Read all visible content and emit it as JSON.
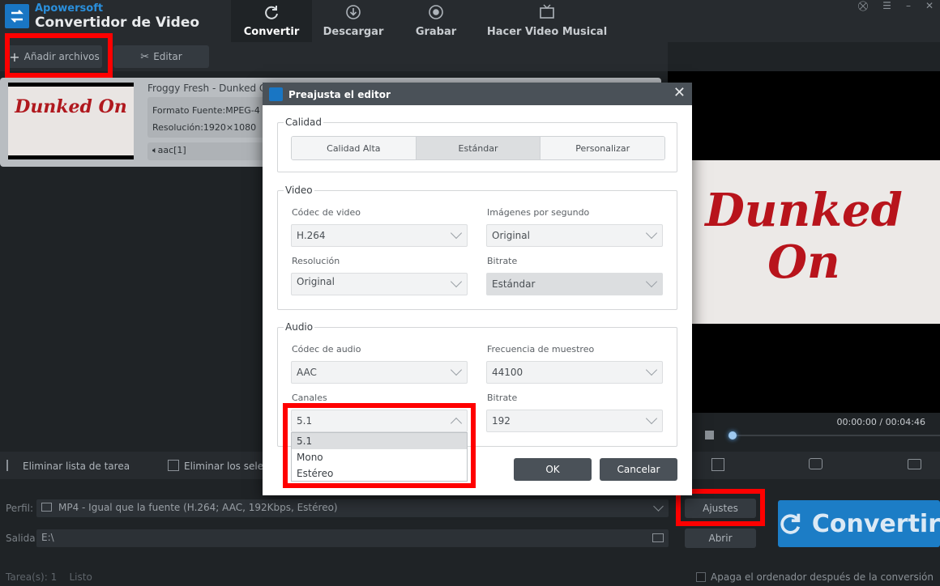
{
  "app": {
    "brand_small": "Apowersoft",
    "brand_big": "Convertidor de Video"
  },
  "nav": {
    "tabs": [
      {
        "label": "Convertir",
        "icon": "refresh-icon",
        "active": true
      },
      {
        "label": "Descargar",
        "icon": "download-icon",
        "active": false
      },
      {
        "label": "Grabar",
        "icon": "record-icon",
        "active": false
      },
      {
        "label": "Hacer Video Musical",
        "icon": "tv-icon",
        "active": false
      }
    ]
  },
  "toolbar": {
    "add_files": "Añadir archivos",
    "edit": "Editar"
  },
  "file": {
    "thumb_text": "Dunked On",
    "title": "Froggy Fresh - Dunked On",
    "format": "Formato Fuente:MPEG-4",
    "resolution": "Resolución:1920×1080",
    "audio": "aac[1]"
  },
  "preview": {
    "frame_text": "Dunked On",
    "timecode": "00:00:00 / 00:04:46"
  },
  "tasks": {
    "clear_list": "Eliminar lista de tarea",
    "remove_selected": "Eliminar los selecc"
  },
  "bottom": {
    "profile_label": "Perfil:",
    "profile_value": "MP4 - Igual que la fuente (H.264; AAC, 192Kbps, Estéreo)",
    "output_label": "Salida:",
    "output_value": "E:\\",
    "settings_button": "Ajustes",
    "open_button": "Abrir",
    "convert_button": "Convertir",
    "status_tasks": "Tarea(s): 1",
    "status_state": "Listo",
    "shutdown": "Apaga el ordenador después de la conversión"
  },
  "modal": {
    "title": "Preajusta el editor",
    "quality": {
      "legend": "Calidad",
      "options": [
        "Calidad Alta",
        "Estándar",
        "Personalizar"
      ],
      "selected": "Estándar"
    },
    "video": {
      "legend": "Video",
      "codec_label": "Códec de video",
      "codec_value": "H.264",
      "fps_label": "Imágenes por segundo",
      "fps_value": "Original",
      "resolution_label": "Resolución",
      "resolution_value": "Original",
      "bitrate_label": "Bitrate",
      "bitrate_value": "Estándar"
    },
    "audio": {
      "legend": "Audio",
      "codec_label": "Códec de audio",
      "codec_value": "AAC",
      "sample_label": "Frecuencia de muestreo",
      "sample_value": "44100",
      "channels_label": "Canales",
      "channels_value": "5.1",
      "channels_options": [
        "5.1",
        "Mono",
        "Estéreo"
      ],
      "bitrate_label": "Bitrate",
      "bitrate_value": "192"
    },
    "ok": "OK",
    "cancel": "Cancelar"
  },
  "colors": {
    "accent": "#1c7dc6",
    "highlight": "#ff0000",
    "dark_bg": "#1f2326"
  }
}
